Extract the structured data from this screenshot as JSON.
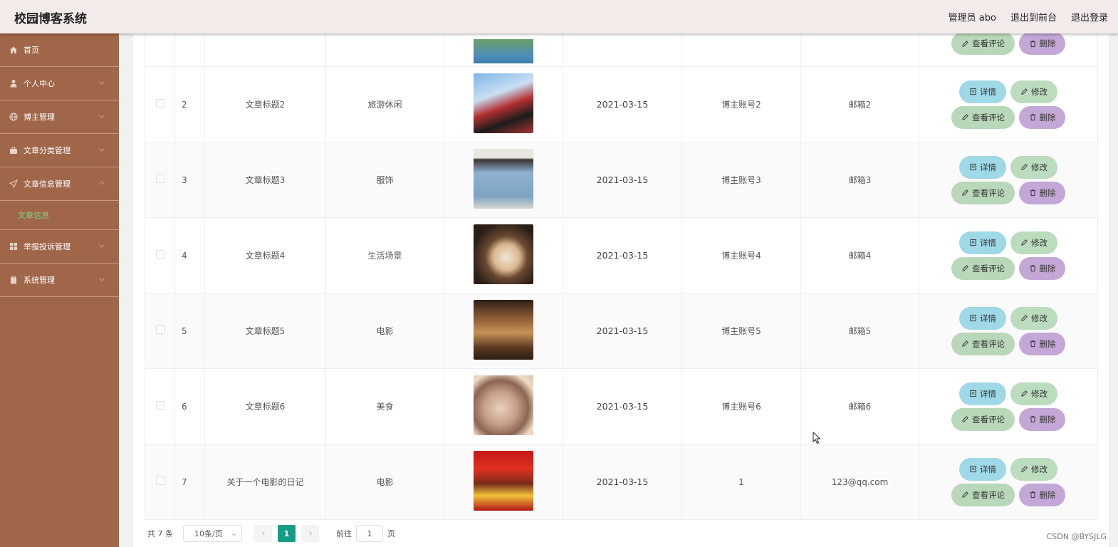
{
  "header": {
    "title": "校园博客系统",
    "admin_label": "管理员 abo",
    "to_front": "退出到前台",
    "logout": "退出登录"
  },
  "sidebar": {
    "items": [
      {
        "label": "首页",
        "icon": "home-icon"
      },
      {
        "label": "个人中心",
        "icon": "user-icon"
      },
      {
        "label": "博主管理",
        "icon": "globe-icon"
      },
      {
        "label": "文章分类管理",
        "icon": "briefcase-icon"
      },
      {
        "label": "文章信息管理",
        "icon": "send-icon"
      },
      {
        "label": "举报投诉管理",
        "icon": "grid-icon"
      },
      {
        "label": "系统管理",
        "icon": "clipboard-icon"
      }
    ],
    "sub_active": "文章信息",
    "accent_color": "#7fd17f"
  },
  "buttons": {
    "detail": "详情",
    "edit": "修改",
    "comments": "查看评论",
    "delete": "删除"
  },
  "rows": [
    {
      "index": "2",
      "title": "文章标题2",
      "category": "旅游休闲",
      "image": "disney-couple-photo",
      "date": "2021-03-15",
      "account": "博主账号2",
      "email": "邮箱2"
    },
    {
      "index": "3",
      "title": "文章标题3",
      "category": "服饰",
      "image": "blue-hoodie-photo",
      "date": "2021-03-15",
      "account": "博主账号3",
      "email": "邮箱3"
    },
    {
      "index": "4",
      "title": "文章标题4",
      "category": "生活场景",
      "image": "coffee-cup-photo",
      "date": "2021-03-15",
      "account": "博主账号4",
      "email": "邮箱4"
    },
    {
      "index": "5",
      "title": "文章标题5",
      "category": "电影",
      "image": "movie-poster-photo",
      "date": "2021-03-15",
      "account": "博主账号5",
      "email": "邮箱5"
    },
    {
      "index": "6",
      "title": "文章标题6",
      "category": "美食",
      "image": "food-dish-photo",
      "date": "2021-03-15",
      "account": "博主账号6",
      "email": "邮箱6"
    },
    {
      "index": "7",
      "title": "关于一个电影的日记",
      "category": "电影",
      "image": "red-movie-poster-photo",
      "date": "2021-03-15",
      "account": "1",
      "email": "123@qq.com"
    }
  ],
  "pagination": {
    "total": "共 7 条",
    "page_size": "10条/页",
    "current_page": "1",
    "goto_label": "前往",
    "goto_value": "1",
    "page_suffix": "页",
    "active_color": "#159e83"
  },
  "watermark": "CSDN @BYSJLG"
}
